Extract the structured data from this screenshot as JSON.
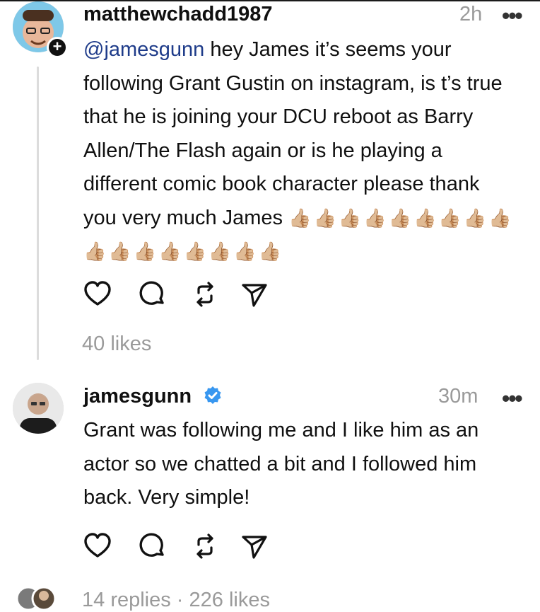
{
  "post": {
    "username": "matthewchadd1987",
    "time": "2h",
    "more": "•••",
    "mention": "@jamesgunn",
    "lines": [
      " hey James it’s seems your",
      "following Grant Gustin on instagram, is t’s true",
      "that he is joining your DCU reboot as Barry",
      "Allen/The Flash again or is he playing a",
      "different comic book character please thank",
      "you very much James"
    ],
    "thumbs_line6": [
      "👍🏼",
      "👍🏼",
      "👍🏼",
      "👍🏼",
      "👍🏼",
      "👍🏼",
      "👍🏼",
      "👍🏼",
      "👍🏼"
    ],
    "thumbs_line7": [
      "👍🏼",
      "👍🏼",
      "👍🏼",
      "👍🏼",
      "👍🏼",
      "👍🏼",
      "👍🏼",
      "👍🏼"
    ],
    "likes": "40 likes"
  },
  "reply": {
    "username": "jamesgunn",
    "verified_icon": "verified-badge-icon",
    "time": "30m",
    "more": "•••",
    "lines": [
      "Grant was following me and I like him as an",
      "actor so we chatted a bit and I followed him",
      "back. Very simple!"
    ],
    "footer": "14 replies · 226 likes"
  },
  "colors": {
    "mention": "#1f3c8a",
    "muted": "#9a9a9a",
    "verified": "#3897f0"
  }
}
